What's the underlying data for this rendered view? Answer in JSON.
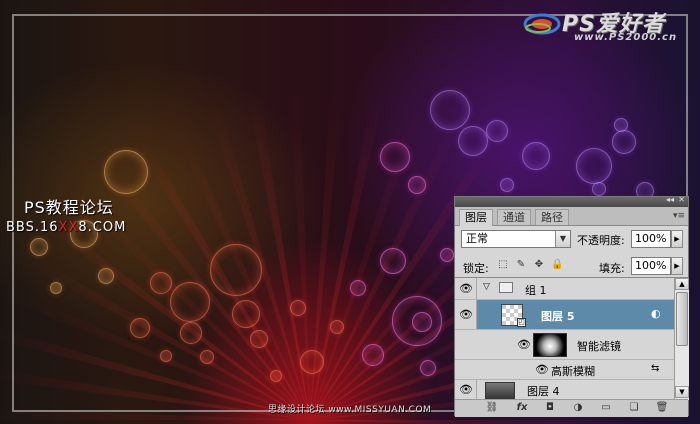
{
  "logo": {
    "word": "PS爱好者",
    "url": "www.PS2000.cn"
  },
  "watermark": {
    "line1": "PS教程论坛",
    "line2_pre": "BBS.16",
    "line2_red": "XX",
    "line2_post": "8.COM"
  },
  "footer": "思缘设计论坛 www.MISSYUAN.COM",
  "panel": {
    "tabs": [
      "图层",
      "通道",
      "路径"
    ],
    "active_tab": "图层",
    "blend_mode": "正常",
    "opacity_label": "不透明度:",
    "opacity_value": "100%",
    "lock_label": "锁定:",
    "fill_label": "填充:",
    "fill_value": "100%",
    "layers": [
      {
        "name": "组 1",
        "kind": "group",
        "visible": true,
        "expanded": true
      },
      {
        "name": "图层 5",
        "kind": "smart-object",
        "visible": true,
        "selected": true
      },
      {
        "name": "智能滤镜",
        "kind": "smart-filter-mask",
        "visible": true
      },
      {
        "name": "高斯模糊",
        "kind": "filter",
        "visible": true
      },
      {
        "name": "图层 4",
        "kind": "layer",
        "visible": true
      }
    ],
    "bottom_icons": [
      "link-icon",
      "fx-icon",
      "mask-icon",
      "adjustment-icon",
      "folder-icon",
      "new-layer-icon",
      "trash-icon"
    ]
  },
  "colors": {
    "panel_bg": "#d6d6d6",
    "selected_row": "#5c8aa8",
    "watermark_red": "#e02020"
  }
}
